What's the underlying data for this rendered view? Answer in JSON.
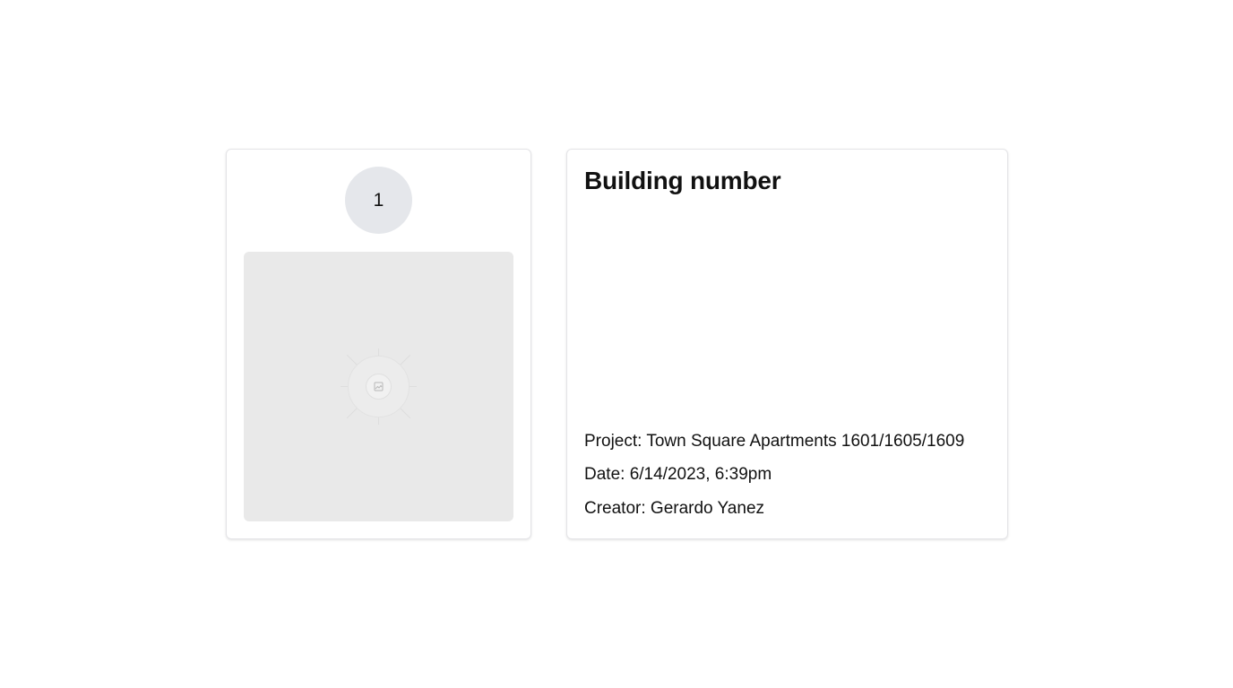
{
  "card": {
    "badge_number": "1",
    "image_icon": "image-placeholder-icon"
  },
  "details": {
    "title": "Building number",
    "project": "Project: Town Square Apartments 1601/1605/1609",
    "date": "Date: 6/14/2023, 6:39pm",
    "creator": "Creator: Gerardo Yanez"
  },
  "colors": {
    "card_border": "#e4e4e7",
    "badge_bg": "#e5e7eb",
    "placeholder_bg": "#e9e9e9"
  }
}
